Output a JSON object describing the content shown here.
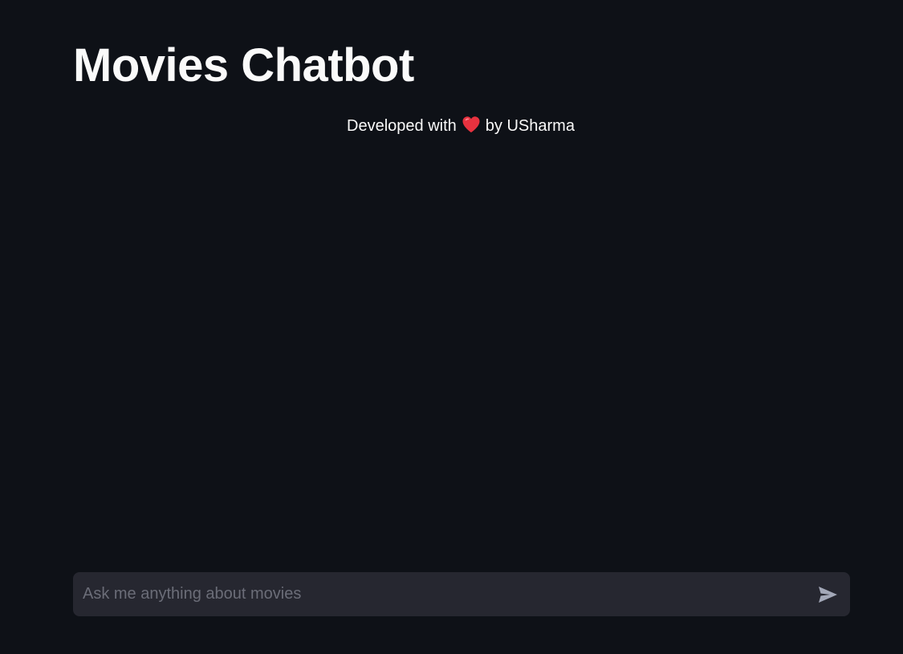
{
  "header": {
    "title": "Movies Chatbot"
  },
  "credit": {
    "prefix": "Developed with",
    "icon": "heart-icon",
    "suffix": "by USharma"
  },
  "chat_input": {
    "placeholder": "Ask me anything about movies",
    "value": "",
    "send_icon": "send-icon"
  },
  "colors": {
    "background": "#0e1117",
    "input_background": "#262730",
    "text": "#fafafa",
    "placeholder": "#6b6d78",
    "send_icon": "#a3a8b8",
    "heart": "#e8323f"
  }
}
